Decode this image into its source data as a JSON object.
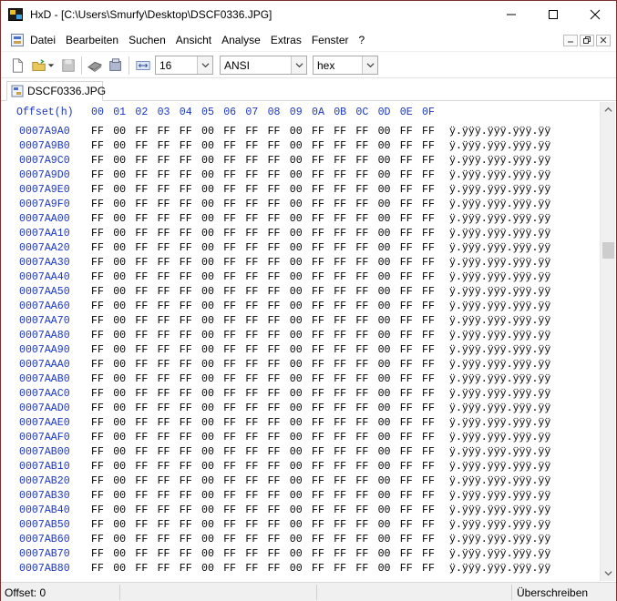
{
  "window": {
    "title": "HxD - [C:\\Users\\Smurfy\\Desktop\\DSCF0336.JPG]"
  },
  "menu": {
    "items": [
      "Datei",
      "Bearbeiten",
      "Suchen",
      "Ansicht",
      "Analyse",
      "Extras",
      "Fenster",
      "?"
    ]
  },
  "toolbar": {
    "bytes_per_row": "16",
    "charset": "ANSI",
    "offset_base": "hex"
  },
  "tab": {
    "label": "DSCF0336.JPG"
  },
  "hex": {
    "header_offset": "Offset(h)",
    "columns": [
      "00",
      "01",
      "02",
      "03",
      "04",
      "05",
      "06",
      "07",
      "08",
      "09",
      "0A",
      "0B",
      "0C",
      "0D",
      "0E",
      "0F"
    ],
    "row_bytes": [
      "FF",
      "00",
      "FF",
      "FF",
      "FF",
      "00",
      "FF",
      "FF",
      "FF",
      "00",
      "FF",
      "FF",
      "FF",
      "00",
      "FF",
      "FF"
    ],
    "row_text": "ÿ.ÿÿÿ.ÿÿÿ.ÿÿÿ.ÿÿ",
    "offsets": [
      "0007A9A0",
      "0007A9B0",
      "0007A9C0",
      "0007A9D0",
      "0007A9E0",
      "0007A9F0",
      "0007AA00",
      "0007AA10",
      "0007AA20",
      "0007AA30",
      "0007AA40",
      "0007AA50",
      "0007AA60",
      "0007AA70",
      "0007AA80",
      "0007AA90",
      "0007AAA0",
      "0007AAB0",
      "0007AAC0",
      "0007AAD0",
      "0007AAE0",
      "0007AAF0",
      "0007AB00",
      "0007AB10",
      "0007AB20",
      "0007AB30",
      "0007AB40",
      "0007AB50",
      "0007AB60",
      "0007AB70",
      "0007AB80"
    ]
  },
  "status": {
    "offset": "Offset: 0",
    "mode": "Überschreiben"
  },
  "colors": {
    "offset_blue": "#1a35c6",
    "window_border": "#7a3030"
  }
}
